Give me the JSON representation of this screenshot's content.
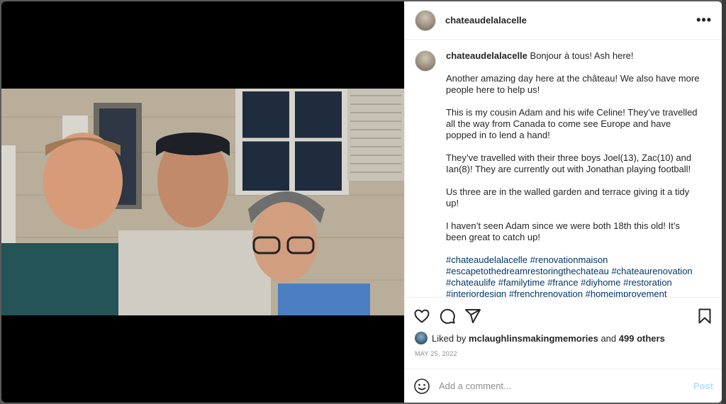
{
  "post": {
    "username": "chateaudelalacelle",
    "more_label": "•••"
  },
  "caption": {
    "username": "chateaudelalacelle",
    "first_line": "Bonjour à tous! Ash here!",
    "paragraphs": [
      "Another amazing day here at the château! We also have more people here to help us!",
      "This is my cousin Adam and his wife Celine! They’ve travelled all the way from Canada to come see Europe and have popped in to lend a hand!",
      "They’ve travelled with their three boys Joel(13), Zac(10) and Ian(8)! They are currently out with Jonathan playing football!",
      "Us three are in the walled garden and terrace giving it a tidy up!",
      "I haven’t seen Adam since we were both 18th this old! It’s been great to catch up!"
    ],
    "hashtags": [
      "#chateaudelalacelle",
      "#renovationmaison",
      "#escapetothedreamrestoringthechateau",
      "#chateaurenovation",
      "#chateaulife",
      "#familytime",
      "#france",
      "#diyhome",
      "#restoration",
      "#interiordesign",
      "#frenchrenovation",
      "#homeimprovement"
    ]
  },
  "likes": {
    "prefix": "Liked by",
    "user": "mclaughlinsmakingmemories",
    "joiner": "and",
    "others": "499 others"
  },
  "date": "MAY 25, 2022",
  "comment": {
    "placeholder": "Add a comment...",
    "post_label": "Post"
  },
  "colors": {
    "link": "#00376b",
    "post_disabled": "#b2dffc",
    "muted": "#8e8e8e"
  },
  "icons": [
    "more-icon",
    "heart-icon",
    "comment-icon",
    "share-icon",
    "bookmark-icon",
    "emoji-icon"
  ]
}
